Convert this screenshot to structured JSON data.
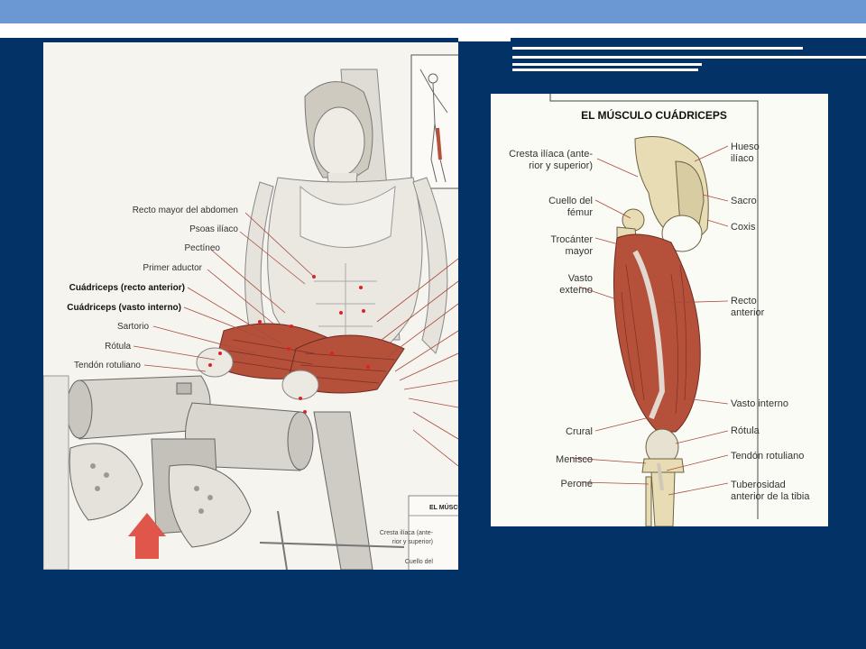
{
  "left_figure": {
    "labels": [
      "Recto mayor del abdomen",
      "Psoas ilíaco",
      "Pectíneo",
      "Primer aductor",
      "Cuádriceps (recto anterior)",
      "Cuádriceps (vasto interno)",
      "Sartorio",
      "Rótula",
      "Tendón rotuliano"
    ],
    "inset_title": "EL MÚSCU",
    "inset_label_1": "Cresta ilíaca (ante-",
    "inset_label_2": "rior y superior)",
    "inset_label_3": "Cuello del"
  },
  "right_figure": {
    "title": "EL MÚSCULO CUÁDRICEPS",
    "left_labels": {
      "cresta_1": "Cresta ilíaca (ante-",
      "cresta_2": "rior y superior)",
      "cuello_1": "Cuello del",
      "cuello_2": "fémur",
      "trocanter_1": "Trocánter",
      "trocanter_2": "mayor",
      "vasto_externo_1": "Vasto",
      "vasto_externo_2": "externo",
      "crural": "Crural",
      "menisco": "Menisco",
      "perone": "Peroné"
    },
    "right_labels": {
      "hueso_1": "Hueso",
      "hueso_2": "ilíaco",
      "sacro": "Sacro",
      "coxis": "Coxis",
      "recto_1": "Recto",
      "recto_2": "anterior",
      "vasto_interno": "Vasto interno",
      "rotula": "Rótula",
      "tendon": "Tendón rotuliano",
      "tuberosidad_1": "Tuberosidad",
      "tuberosidad_2": "anterior de la tibia"
    }
  },
  "colors": {
    "background": "#033366",
    "top_bar": "#6b97d2",
    "muscle": "#b5503a",
    "arrow": "#e0564a"
  }
}
